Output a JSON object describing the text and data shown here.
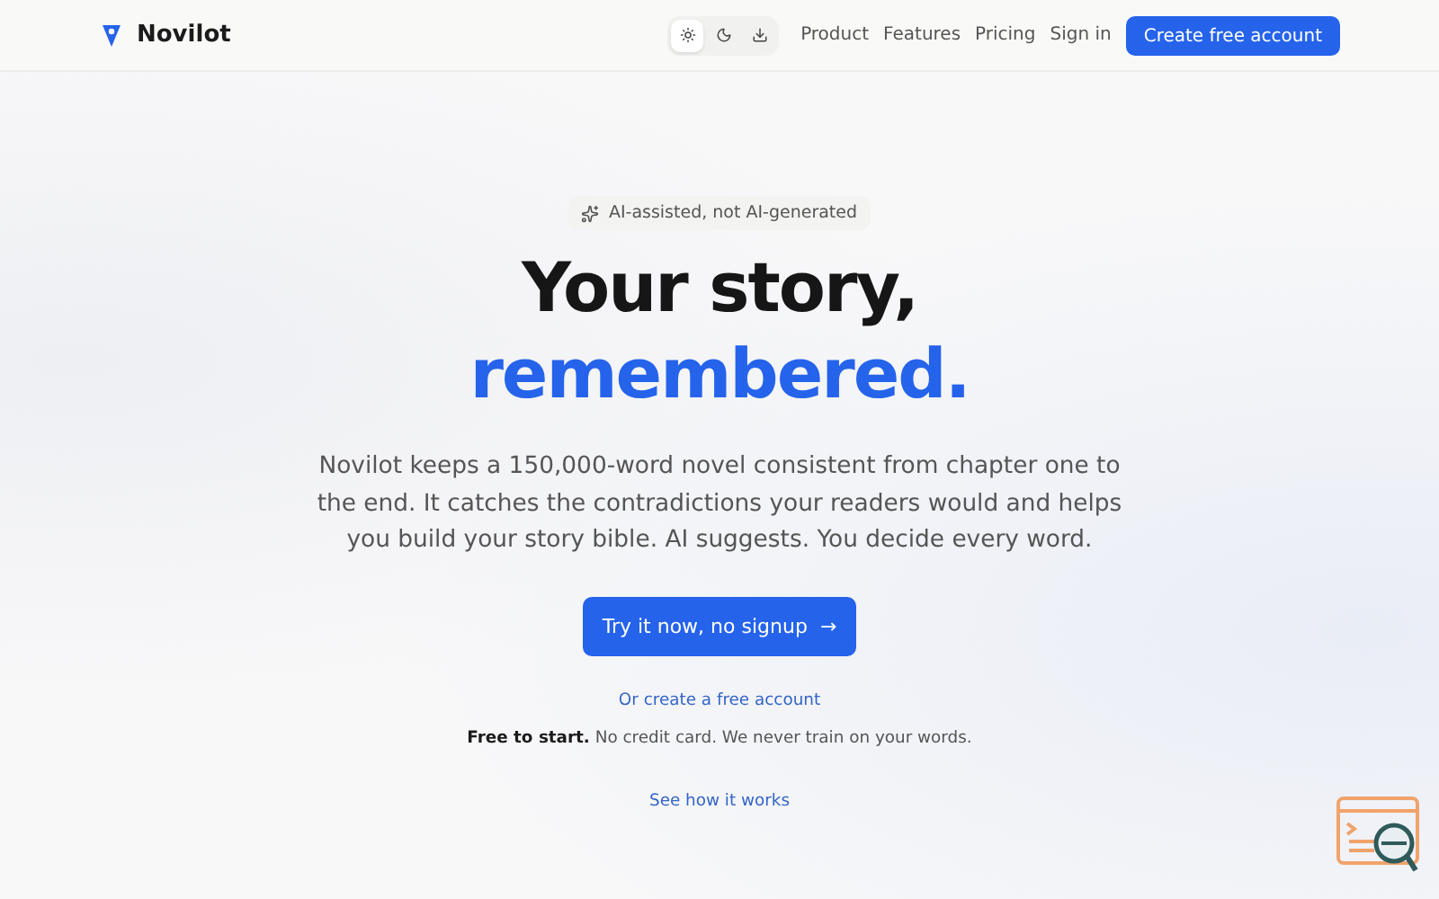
{
  "brand": {
    "name": "Novilot"
  },
  "theme_options": [
    {
      "kind": "light",
      "selected": true
    },
    {
      "kind": "dark",
      "selected": false
    },
    {
      "kind": "system",
      "selected": false
    }
  ],
  "nav": [
    "Product",
    "Features",
    "Pricing",
    "Sign in"
  ],
  "nav_button": "Create free account",
  "badge": "AI-assisted, not AI-generated",
  "headline": [
    "Your story,",
    "remembered."
  ],
  "description": "Novilot keeps a 150,000-word novel consistent from chapter one to the end. It catches the contradictions your readers would and helps you build your story bible. AI suggests. You decide every word.",
  "cta": "Try it now, no signup",
  "cta_arrow": "→",
  "secondary_link": "Or create a free account",
  "note": "**Free to start.** No credit card. We never train on your words.",
  "more_link": "See how it works"
}
